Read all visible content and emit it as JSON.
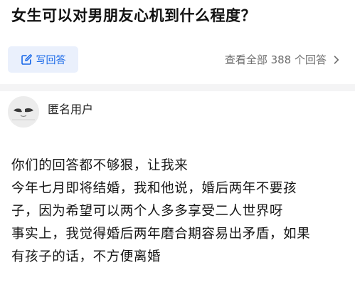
{
  "question": {
    "title": "女生可以对男朋友心机到什么程度？"
  },
  "actions": {
    "write_answer_label": "写回答",
    "view_all_label": "查看全部 388 个回答",
    "accent_color": "#1767e8"
  },
  "author": {
    "name": "匿名用户",
    "avatar_icon": "anonymous-avatar-icon"
  },
  "answer": {
    "lines": [
      "你们的回答都不够狠，让我来",
      "今年七月即将结婚，我和他说，婚后两年不要孩",
      "子，因为希望可以两个人多多享受二人世界呀",
      "事实上，我觉得婚后两年磨合期容易出矛盾，如果",
      "有孩子的话，不方便离婚"
    ]
  }
}
